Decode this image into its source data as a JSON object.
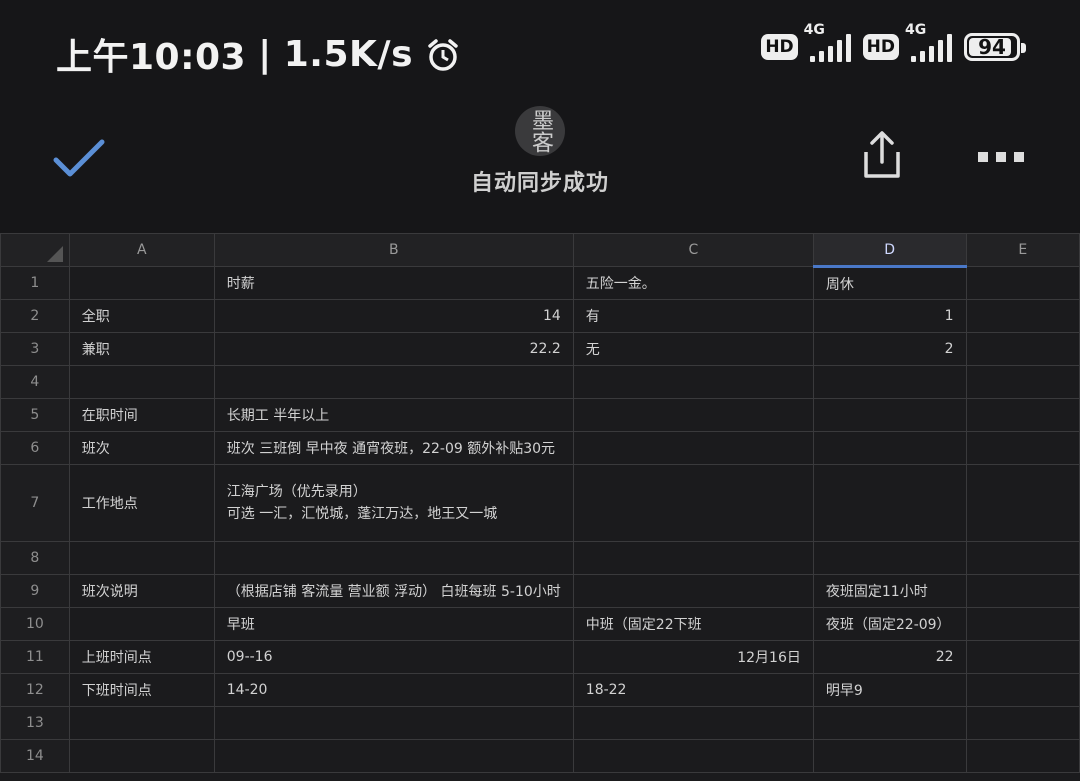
{
  "status_bar": {
    "time": "上午10:03",
    "separator": "|",
    "net_speed": "1.5K/s",
    "hd1": "HD",
    "hd2": "HD",
    "net1": "4G",
    "net2": "4G",
    "battery": "94",
    "alarm_icon": "alarm-clock-icon"
  },
  "toolbar": {
    "avatar_text": "墨客",
    "sync_status": "自动同步成功",
    "icons": [
      "checkmark-icon",
      "share-icon",
      "more-icon"
    ]
  },
  "sheet": {
    "columns": [
      "A",
      "B",
      "C",
      "D",
      "E"
    ],
    "selected_column": "D",
    "rows": [
      {
        "n": "1",
        "a": "",
        "b": "时薪",
        "c": "五险一金。",
        "d": "周休"
      },
      {
        "n": "2",
        "a": "全职",
        "b": "14",
        "c": "有",
        "d": "1"
      },
      {
        "n": "3",
        "a": "兼职",
        "b": "22.2",
        "c": "无",
        "d": "2"
      },
      {
        "n": "4",
        "a": "",
        "b": "",
        "c": "",
        "d": ""
      },
      {
        "n": "5",
        "a": "在职时间",
        "b": "长期工 半年以上",
        "c": "",
        "d": ""
      },
      {
        "n": "6",
        "a": "班次",
        "b": "班次 三班倒  早中夜 通宵夜班，22-09 额外补贴30元",
        "c": "",
        "d": ""
      },
      {
        "n": "7",
        "a": "工作地点",
        "b1": "江海广场（优先录用）",
        "b2": "可选 一汇，汇悦城，蓬江万达，地王又一城",
        "c": "",
        "d": ""
      },
      {
        "n": "8",
        "a": "",
        "b": "",
        "c": "",
        "d": ""
      },
      {
        "n": "9",
        "a": "班次说明",
        "b": "（根据店铺 客流量 营业额 浮动） 白班每班 5-10小时",
        "c": "",
        "d": "夜班固定11小时"
      },
      {
        "n": "10",
        "a": "",
        "b": "早班",
        "c": "中班（固定22下班",
        "d": "夜班（固定22-09）"
      },
      {
        "n": "11",
        "a": "上班时间点",
        "b": "09--16",
        "c": "12月16日",
        "d": "22"
      },
      {
        "n": "12",
        "a": "下班时间点",
        "b": "14-20",
        "c": "18-22",
        "d": "明早9"
      },
      {
        "n": "13",
        "a": "",
        "b": "",
        "c": "",
        "d": ""
      },
      {
        "n": "14",
        "a": "",
        "b": "",
        "c": "",
        "d": ""
      }
    ]
  }
}
